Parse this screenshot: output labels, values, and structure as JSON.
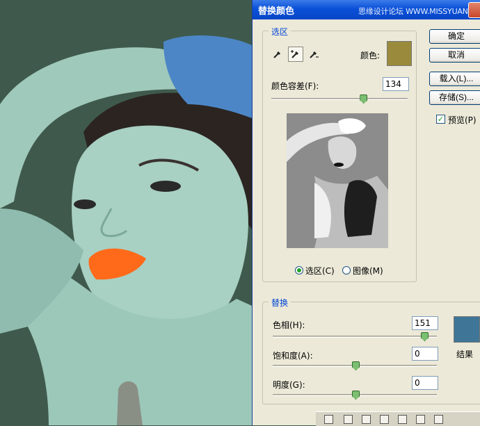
{
  "dialog": {
    "title": "替换颜色",
    "watermark": "思缘设计论坛 WWW.MISSYUAN.COM",
    "buttons": {
      "ok": "确定",
      "cancel": "取消",
      "load": "载入(L)...",
      "save": "存储(S)..."
    },
    "preview_checkbox": {
      "label": "预览(P)",
      "checked": true
    },
    "selection": {
      "legend": "选区",
      "color_label": "颜色:",
      "sample_color": "#9a8b3c",
      "tolerance_label": "颜色容差(F):",
      "tolerance_value": "134",
      "tolerance_fraction": 0.67,
      "radio_selection": "选区(C)",
      "radio_image": "图像(M)",
      "selected_radio": "selection"
    },
    "replacement": {
      "legend": "替换",
      "hue_label": "色相(H):",
      "hue_value": "151",
      "saturation_label": "饱和度(A):",
      "saturation_value": "0",
      "lightness_label": "明度(G):",
      "lightness_value": "0",
      "result_label": "结果",
      "result_color": "#3f7597"
    }
  },
  "colors": {
    "background_photo": "#3f5a4d",
    "skin": "#a8d0c3",
    "lips": "#ff6a1a",
    "sleeve": "#4c86c6",
    "title_bar": "#0a50d8"
  }
}
